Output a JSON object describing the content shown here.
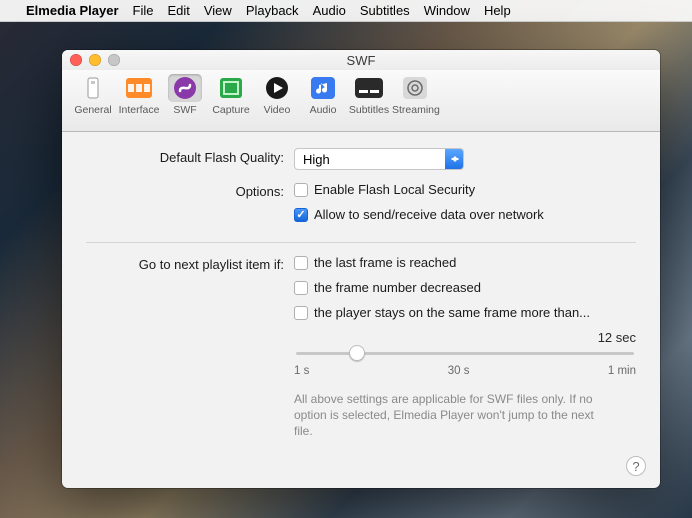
{
  "menubar": {
    "app": "Elmedia Player",
    "items": [
      "File",
      "Edit",
      "View",
      "Playback",
      "Audio",
      "Subtitles",
      "Window",
      "Help"
    ]
  },
  "window": {
    "title": "SWF"
  },
  "toolbar": {
    "tabs": [
      {
        "id": "general",
        "label": "General",
        "icon": "general-icon"
      },
      {
        "id": "interface",
        "label": "Interface",
        "icon": "interface-icon"
      },
      {
        "id": "swf",
        "label": "SWF",
        "icon": "swf-icon"
      },
      {
        "id": "capture",
        "label": "Capture",
        "icon": "capture-icon"
      },
      {
        "id": "video",
        "label": "Video",
        "icon": "video-icon"
      },
      {
        "id": "audio",
        "label": "Audio",
        "icon": "audio-icon"
      },
      {
        "id": "subtitles",
        "label": "Subtitles",
        "icon": "subtitles-icon"
      },
      {
        "id": "streaming",
        "label": "Streaming",
        "icon": "streaming-icon"
      }
    ],
    "selected": "swf"
  },
  "form": {
    "quality": {
      "label": "Default Flash Quality:",
      "value": "High"
    },
    "options": {
      "label": "Options:",
      "items": [
        {
          "label": "Enable Flash Local Security",
          "checked": false
        },
        {
          "label": "Allow to send/receive data over network",
          "checked": true
        }
      ]
    },
    "playlist": {
      "label": "Go to next playlist item if:",
      "items": [
        {
          "label": "the last frame is reached",
          "checked": false
        },
        {
          "label": "the frame number decreased",
          "checked": false
        },
        {
          "label": "the player stays on the same frame more than...",
          "checked": false
        }
      ],
      "slider": {
        "value_label": "12 sec",
        "ticks": [
          "1 s",
          "30 s",
          "1 min"
        ],
        "percent": 18
      },
      "note": "All above settings are applicable for SWF files only. If no option is selected, Elmedia Player won't jump to the next file."
    }
  },
  "help": "?",
  "colors": {
    "accent": "#1f72e8"
  }
}
